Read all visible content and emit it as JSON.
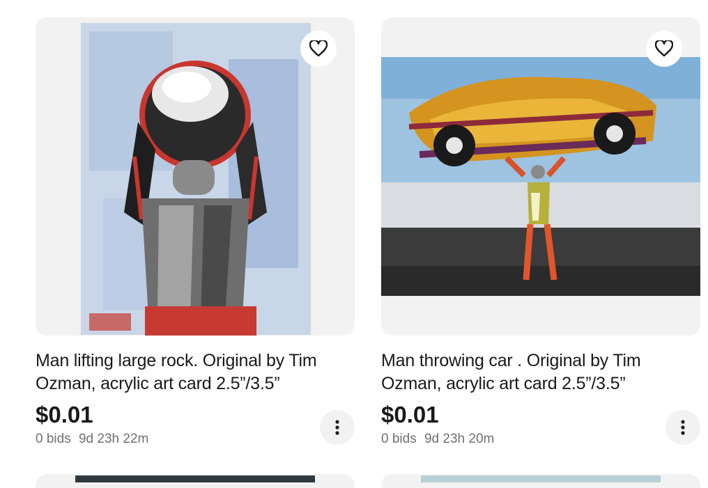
{
  "listings": [
    {
      "title": "Man lifting large rock. Original by Tim Ozman, acrylic art card 2.5”/3.5”",
      "price": "$0.01",
      "bids": "0 bids",
      "time_left": "9d 23h 22m",
      "watch_icon": "heart-outline-icon",
      "more_icon": "vertical-dots-icon"
    },
    {
      "title": "Man throwing car . Original by Tim Ozman, acrylic art card 2.5”/3.5”",
      "price": "$0.01",
      "bids": "0 bids",
      "time_left": "9d 23h 20m",
      "watch_icon": "heart-outline-icon",
      "more_icon": "vertical-dots-icon"
    }
  ],
  "colors": {
    "text": "#191919",
    "muted": "#707070",
    "tile_bg": "#f2f2f2"
  }
}
